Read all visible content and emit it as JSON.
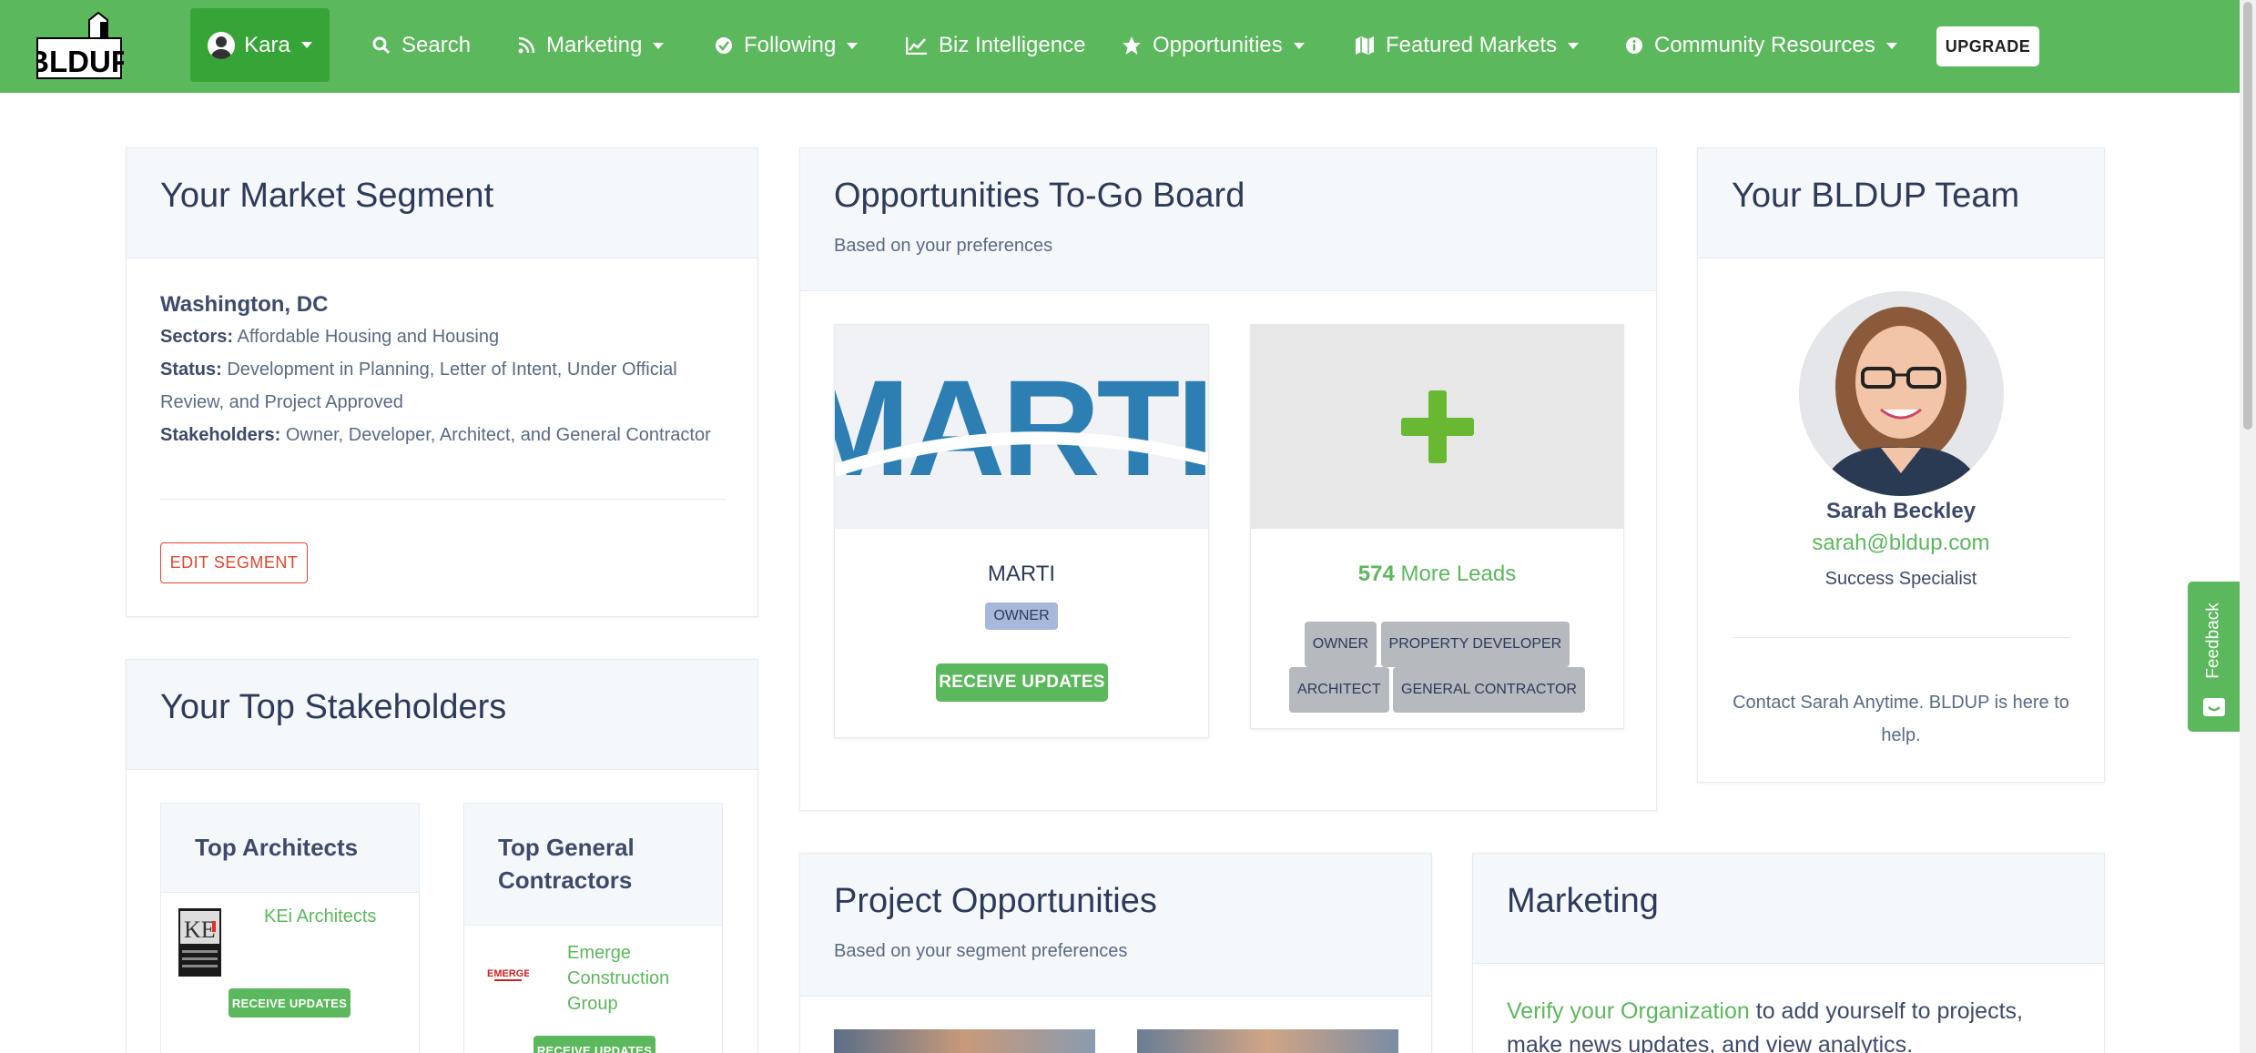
{
  "nav": {
    "logo_text": "BLDUP",
    "user": "Kara",
    "items": [
      "Search",
      "Marketing",
      "Following",
      "Biz Intelligence",
      "Opportunities",
      "Featured Markets",
      "Community Resources"
    ],
    "upgrade": "UPGRADE"
  },
  "segment": {
    "title": "Your Market Segment",
    "city": "Washington, DC",
    "sectors_label": "Sectors:",
    "sectors": "Affordable Housing and Housing",
    "status_label": "Status:",
    "status_line1": "Development in Planning, Letter of Intent, Under Official",
    "status_line2": "Review, and Project Approved",
    "stakeholders_label": "Stakeholders:",
    "stakeholders": "Owner, Developer, Architect, and General Contractor",
    "edit_button": "EDIT SEGMENT"
  },
  "stakeholders": {
    "title": "Your Top Stakeholders",
    "architects": {
      "title": "Top Architects",
      "name": "KEi Architects",
      "button": "RECEIVE UPDATES"
    },
    "contractors": {
      "title_line1": "Top General",
      "title_line2": "Contractors",
      "name_line1": "Emerge",
      "name_line2": "Construction",
      "name_line3": "Group",
      "logo_text": "EMERGE",
      "button": "RECEIVE UPDATES"
    }
  },
  "togo": {
    "title": "Opportunities To-Go Board",
    "subtitle": "Based on your preferences",
    "lead1": {
      "logo_text": "MARTI",
      "name": "MARTI",
      "badge": "OWNER",
      "button": "RECEIVE UPDATES"
    },
    "lead2": {
      "count": "574",
      "label": "More Leads",
      "badges": [
        "OWNER",
        "PROPERTY DEVELOPER",
        "ARCHITECT",
        "GENERAL CONTRACTOR"
      ]
    }
  },
  "team": {
    "title": "Your BLDUP Team",
    "name": "Sarah Beckley",
    "email": "sarah@bldup.com",
    "role": "Success Specialist",
    "note_line1": "Contact Sarah Anytime. BLDUP is here to",
    "note_line2": "help."
  },
  "projects": {
    "title": "Project Opportunities",
    "subtitle": "Based on your segment preferences"
  },
  "marketing": {
    "title": "Marketing",
    "link": "Verify your Organization",
    "text_line1": " to add yourself to projects,",
    "text_line2": "make news updates, and view analytics."
  },
  "feedback": "Feedback",
  "colors": {
    "brand_green": "#5cb85c",
    "dark_green": "#37a437",
    "danger": "#e0452c"
  }
}
